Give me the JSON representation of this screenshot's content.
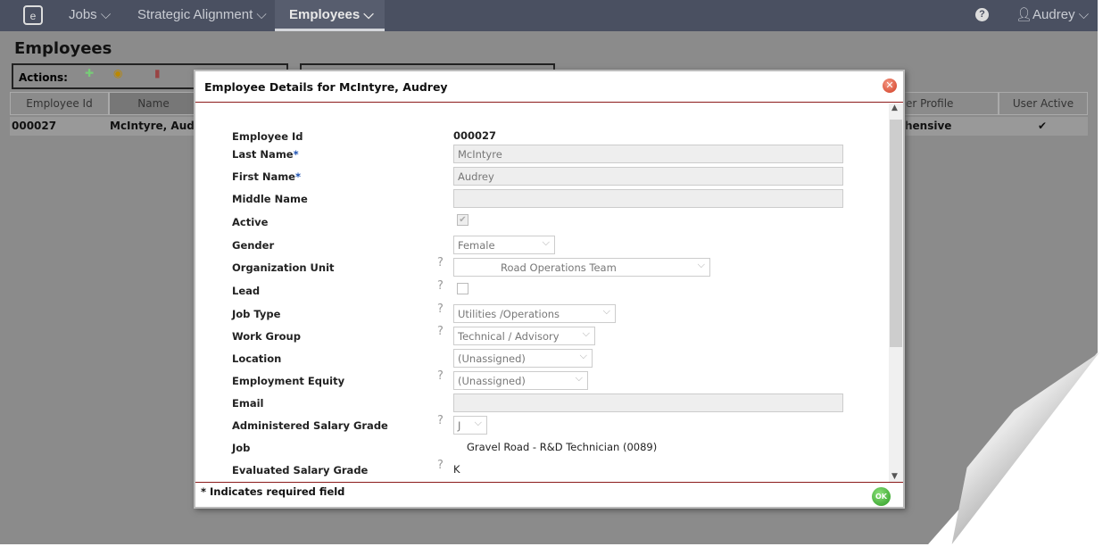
{
  "nav": {
    "items": [
      {
        "label": "Jobs ⌵"
      },
      {
        "label": "Strategic Alignment ⌵"
      },
      {
        "label": "Employees ⌵"
      }
    ],
    "help": "?",
    "user": "Audrey ⌵"
  },
  "page": {
    "title": "Employees",
    "actions_label": "Actions:"
  },
  "table": {
    "headers": [
      "Employee Id",
      "Name",
      "er Profile",
      "User Active"
    ],
    "row": {
      "id": "000027",
      "name": "McIntyre, Aud",
      "profile": "hensive",
      "active": "✔"
    }
  },
  "modal": {
    "title": "Employee Details for McIntyre, Audrey",
    "close": "✕",
    "fields": {
      "employee_id": {
        "label": "Employee Id",
        "value": "000027"
      },
      "last_name": {
        "label": "Last Name",
        "value": "McIntyre",
        "req": "*"
      },
      "first_name": {
        "label": "First Name",
        "value": "Audrey",
        "req": "*"
      },
      "middle_name": {
        "label": "Middle Name",
        "value": ""
      },
      "active": {
        "label": "Active",
        "value": "✔"
      },
      "gender": {
        "label": "Gender",
        "value": "Female"
      },
      "org_unit": {
        "label": "Organization Unit",
        "value": "Road Operations Team"
      },
      "lead": {
        "label": "Lead",
        "value": ""
      },
      "job_type": {
        "label": "Job Type",
        "value": "Utilities /Operations"
      },
      "work_group": {
        "label": "Work Group",
        "value": "Technical / Advisory"
      },
      "location": {
        "label": "Location",
        "value": "(Unassigned)"
      },
      "equity": {
        "label": "Employment Equity",
        "value": "(Unassigned)"
      },
      "email": {
        "label": "Email",
        "value": ""
      },
      "admin_grade": {
        "label": "Administered Salary Grade",
        "value": "J"
      },
      "job": {
        "label": "Job",
        "value": "Gravel Road - R&D Technician (0089)"
      },
      "eval_grade": {
        "label": "Evaluated Salary Grade",
        "value": "K"
      }
    },
    "help_icon": "?",
    "footer": "* Indicates required field",
    "ok": "OK"
  }
}
